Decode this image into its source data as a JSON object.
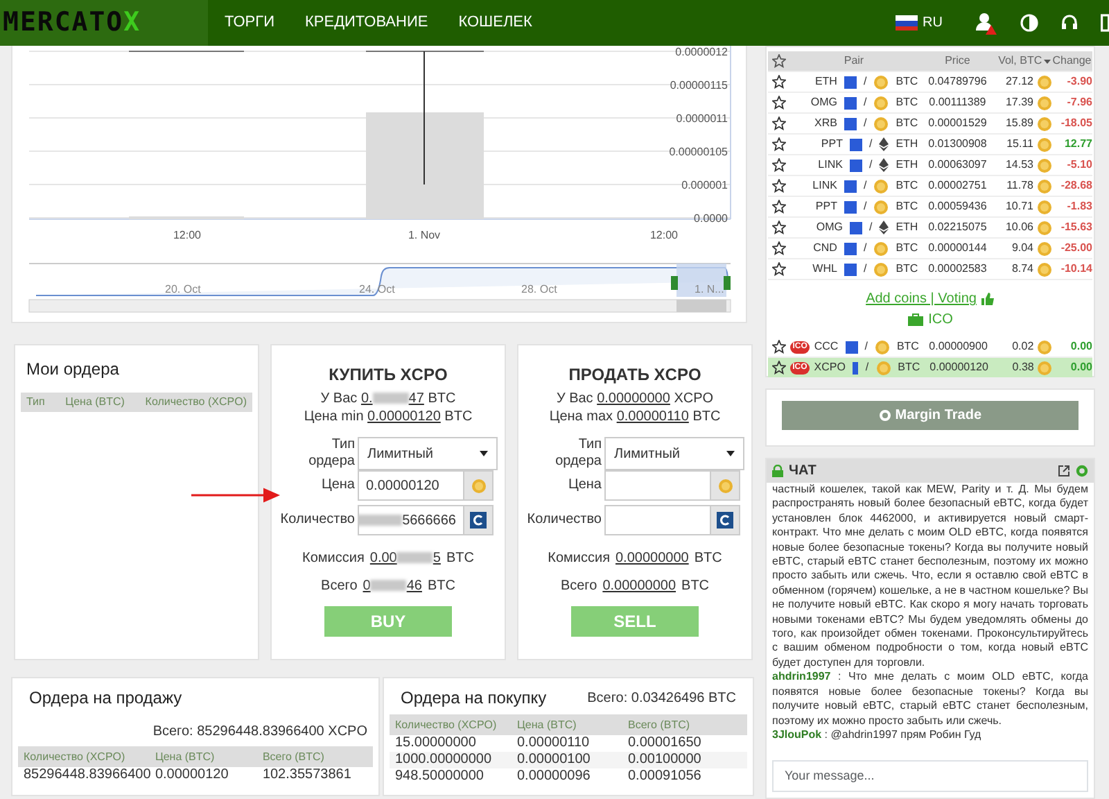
{
  "navbar": {
    "logo": [
      "MERCATO",
      "X"
    ],
    "menu": [
      {
        "label": "ТОРГИ"
      },
      {
        "label": "КРЕДИТОВАНИЕ"
      },
      {
        "label": "КОШЕЛЕК"
      }
    ],
    "language": "RU"
  },
  "price_chart": {
    "y_labels": [
      "0.0000012",
      "0.00000115",
      "0.0000011",
      "0.00000105",
      "0.000001",
      "0.0000"
    ],
    "x_labels": [
      "12:00",
      "1. Nov",
      "12:00"
    ],
    "navigator_labels": [
      "20. Oct",
      "24. Oct",
      "28. Oct",
      "1. N..."
    ]
  },
  "my_orders": {
    "title": "Мои ордера",
    "columns": [
      "Тип",
      "Цена (BTC)",
      "Количество (XCPO)"
    ]
  },
  "buy_form": {
    "title": "КУПИТЬ XCPO",
    "balance": {
      "label": "У Вас",
      "amount": [
        "0.",
        "47"
      ],
      "unit": "BTC"
    },
    "price_limit": {
      "label": "Цена min",
      "amount": [
        "0.00000120"
      ],
      "unit": "BTC"
    },
    "order_type": {
      "label": "Тип ордера",
      "value": "Лимитный"
    },
    "price": {
      "label": "Цена",
      "value": "0.00000120"
    },
    "quantity": {
      "label": "Количество",
      "value": "5666666",
      "masked": true
    },
    "fee": {
      "label": "Комиссия",
      "amount": [
        "0.00",
        "5"
      ],
      "unit": "BTC"
    },
    "total": {
      "label": "Всего",
      "amount": [
        "0",
        "46"
      ],
      "unit": "BTC"
    },
    "button": "BUY"
  },
  "sell_form": {
    "title": "ПРОДАТЬ XCPO",
    "balance": {
      "label": "У Вас",
      "amount": [
        "0.00000000"
      ],
      "unit": "XCPO"
    },
    "price_limit": {
      "label": "Цена max",
      "amount": [
        "0.00000110"
      ],
      "unit": "BTC"
    },
    "order_type": {
      "label": "Тип ордера",
      "value": "Лимитный"
    },
    "price": {
      "label": "Цена"
    },
    "quantity": {
      "label": "Количество"
    },
    "fee": {
      "label": "Комиссия",
      "amount": [
        "0.00000000"
      ],
      "unit": "BTC"
    },
    "total": {
      "label": "Всего",
      "amount": [
        "0.00000000"
      ],
      "unit": "BTC"
    },
    "button": "SELL"
  },
  "sell_orders": {
    "title": "Ордера на продажу",
    "total": "Всего: 85296448.83966400 XCPO",
    "columns": [
      "Количество (XCPO)",
      "Цена (BTC)",
      "Всего (BTC)"
    ],
    "rows": [
      [
        "85296448.83966400",
        "0.00000120",
        "102.35573861"
      ]
    ]
  },
  "buy_orders": {
    "title": "Ордера на покупку",
    "total": "Всего: 0.03426496 BTC",
    "columns": [
      "Количество (XCPO)",
      "Цена (BTC)",
      "Всего (BTC)"
    ],
    "rows": [
      [
        "15.00000000",
        "0.00000110",
        "0.00001650"
      ],
      [
        "1000.00000000",
        "0.00000100",
        "0.00100000"
      ],
      [
        "948.50000000",
        "0.00000096",
        "0.00091056"
      ]
    ]
  },
  "market": {
    "columns": [
      "Pair",
      "Price",
      "Vol, BTC",
      "Change"
    ],
    "separator": "/",
    "rows": [
      {
        "base": "ETH",
        "quote": "BTC",
        "kind": "btc",
        "price": "0.04789796",
        "volume": "27.12",
        "change": "-3.90",
        "color": "#d9534f"
      },
      {
        "base": "OMG",
        "quote": "BTC",
        "kind": "btc",
        "price": "0.00111389",
        "volume": "17.39",
        "change": "-7.96",
        "color": "#d9534f"
      },
      {
        "base": "XRB",
        "quote": "BTC",
        "kind": "btc",
        "price": "0.00001529",
        "volume": "15.89",
        "change": "-18.05",
        "color": "#d9534f"
      },
      {
        "base": "PPT",
        "quote": "ETH",
        "kind": "eth",
        "price": "0.01300908",
        "volume": "15.11",
        "change": "12.77",
        "color": "#2e9e2e"
      },
      {
        "base": "LINK",
        "quote": "ETH",
        "kind": "eth",
        "price": "0.00063097",
        "volume": "14.53",
        "change": "-5.10",
        "color": "#d9534f"
      },
      {
        "base": "LINK",
        "quote": "BTC",
        "kind": "btc",
        "price": "0.00002751",
        "volume": "11.78",
        "change": "-28.68",
        "color": "#d9534f"
      },
      {
        "base": "PPT",
        "quote": "BTC",
        "kind": "btc",
        "price": "0.00059436",
        "volume": "10.71",
        "change": "-1.83",
        "color": "#d9534f"
      },
      {
        "base": "OMG",
        "quote": "ETH",
        "kind": "eth",
        "price": "0.02215075",
        "volume": "10.06",
        "change": "-15.63",
        "color": "#d9534f"
      },
      {
        "base": "CND",
        "quote": "BTC",
        "kind": "btc",
        "price": "0.00000144",
        "volume": "9.04",
        "change": "-25.00",
        "color": "#d9534f"
      },
      {
        "base": "WHL",
        "quote": "BTC",
        "kind": "btc",
        "price": "0.00002583",
        "volume": "8.74",
        "change": "-10.14",
        "color": "#d9534f"
      }
    ],
    "add_link": "Add coins | Voting",
    "ico_link": "ICO",
    "ico_rows": [
      {
        "badge": "ICO",
        "base": "CCC",
        "quote": "BTC",
        "kind": "btc",
        "price": "0.00000900",
        "volume": "0.02",
        "change": "0.00",
        "color": "#2e9e2e",
        "selected": false
      },
      {
        "badge": "ICO",
        "base": "XCPO",
        "quote": "BTC",
        "kind": "btc",
        "price": "0.00000120",
        "volume": "0.38",
        "change": "0.00",
        "color": "#2e9e2e",
        "selected": true
      }
    ]
  },
  "margin_button": "Margin Trade",
  "chat": {
    "title": "ЧАТ",
    "separator": ":",
    "messages": [
      {
        "text": "частный кошелек, такой как MEW, Parity и т. Д. Мы будем распространять новый более безопасный eBTC, когда будет установлен блок 4462000, и активируется новый смарт-контракт. Что мне делать с моим OLD eBTC, когда появятся новые более безопасные токены? Когда вы получите новый eBTC, старый eBTC станет бесполезным, поэтому их можно просто забыть или сжечь. Что, если я оставлю свой eBTC в обменном (горячем) кошельке, а не в частном кошельке? Вы не получите новый eBTC. Как скоро я могу начать торговать новыми токенами eBTC? Мы будем уведомлять обмены до того, как произойдет обмен токенами. Проконсультируйтесь с вашим обменом подробности о том, когда новый eBTC будет доступен для торговли."
      },
      {
        "user": "ahdrin1997",
        "text": "Что мне делать с моим OLD eBTC, когда появятся новые более безопасные токены? Когда вы получите новый eBTC, старый eBTC станет бесполезным, поэтому их можно просто забыть или сжечь."
      },
      {
        "user": "3JlouPok",
        "text": "@ahdrin1997 прям Робин Гуд"
      }
    ],
    "placeholder": "Your message..."
  }
}
